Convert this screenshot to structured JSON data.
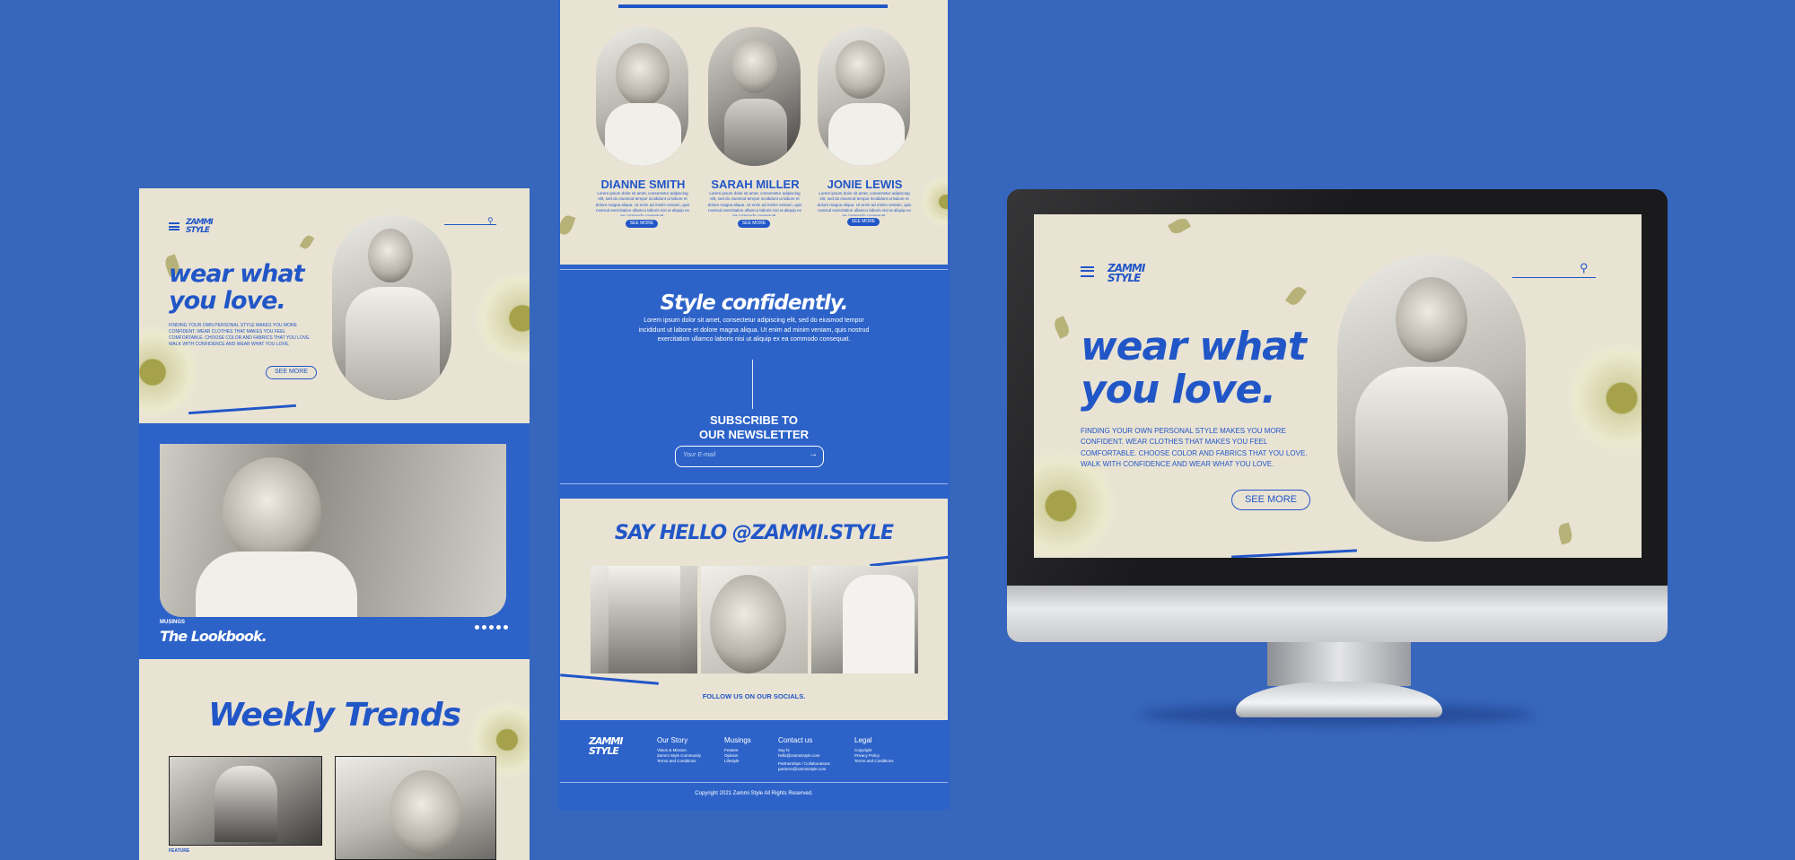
{
  "brand": {
    "logo": "ZAMMI STYLE"
  },
  "left_mockup": {
    "hero": {
      "headline_line1": "wear what",
      "headline_line2": "you love.",
      "body": "FINDING YOUR OWN PERSONAL STYLE MAKES YOU MORE CONFIDENT. WEAR CLOTHES THAT MAKES YOU FEEL COMFORTABLE. CHOOSE COLOR AND FABRICS THAT YOU LOVE. WALK WITH CONFIDENCE AND WEAR WHAT YOU LOVE.",
      "cta": "SEE MORE"
    },
    "lookbook": {
      "eyebrow": "MUSINGS",
      "title": "The Lookbook.",
      "slide_count": 5
    },
    "trends": {
      "title": "Weekly Trends",
      "card_eyebrow": "FEATURE"
    }
  },
  "middle_mockup": {
    "team": [
      {
        "name": "DIANNE SMITH",
        "cta": "SEE MORE"
      },
      {
        "name": "SARAH MILLER",
        "cta": "SEE MORE"
      },
      {
        "name": "JONIE LEWIS",
        "cta": "SEE MORE"
      }
    ],
    "style": {
      "title": "Style confidently.",
      "body": "Lorem ipsum dolor sit amet, consectetur adipiscing elit, sed do eiusmod tempor incididunt ut labore et dolore magna aliqua. Ut enim ad minim veniam, quis nostrud exercitation ullamco laboris nisi ut aliquip ex ea commodo consequat."
    },
    "newsletter": {
      "title_line1": "SUBSCRIBE TO",
      "title_line2": "OUR NEWSLETTER",
      "placeholder": "Your E-mail"
    },
    "social": {
      "title": "SAY HELLO @ZAMMI.STYLE",
      "caption": "FOLLOW US ON OUR SOCIALS."
    },
    "footer": {
      "columns": [
        {
          "heading": "Our Story",
          "links": [
            "Vision & Mission",
            "Zammi Style Community",
            "Terms and Conditions"
          ]
        },
        {
          "heading": "Musings",
          "links": [
            "Feature",
            "Opinion",
            "Lifestyle"
          ]
        },
        {
          "heading": "Contact us",
          "links": [
            "Say hi",
            "hello@zammistyle.com",
            "Partnerships / Collaborations",
            "partners@zammistyle.com"
          ]
        },
        {
          "heading": "Legal",
          "links": [
            "Copyright",
            "Privacy Policy",
            "Terms and Conditions"
          ]
        }
      ],
      "copyright": "Copyright 2021 Zammi Style All Rights Reserved."
    }
  },
  "desktop_mockup": {
    "hero": {
      "headline_line1": "wear what",
      "headline_line2": "you love.",
      "body": "FINDING YOUR OWN PERSONAL STYLE MAKES YOU MORE CONFIDENT. WEAR CLOTHES THAT MAKES YOU FEEL COMFORTABLE. CHOOSE COLOR AND FABRICS THAT YOU LOVE. WALK WITH CONFIDENCE AND WEAR WHAT YOU LOVE.",
      "cta": "SEE MORE"
    }
  },
  "colors": {
    "background": "#3766bd",
    "accent": "#2156c7",
    "cream": "#e9e3d4"
  }
}
